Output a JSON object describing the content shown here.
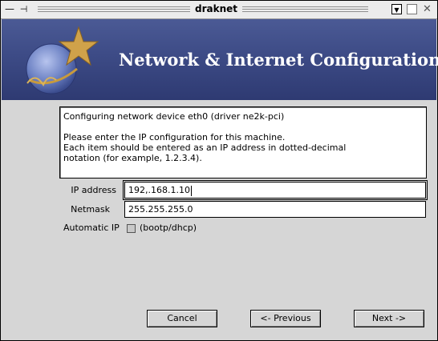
{
  "window": {
    "title": "draknet",
    "controls": {
      "minimize_glyph": "—",
      "pin_glyph": "⊣",
      "menu_glyph": "▼",
      "maximize_glyph": "",
      "close_glyph": "✕"
    }
  },
  "banner": {
    "title": "Network & Internet Configuration"
  },
  "info": {
    "text": "Configuring network device eth0 (driver ne2k-pci)\n\nPlease enter the IP configuration for this machine.\nEach item should be entered as an IP address in dotted-decimal\nnotation (for example, 1.2.3.4)."
  },
  "form": {
    "ip_label": "IP address",
    "ip_value": "192,.168.1.10",
    "netmask_label": "Netmask",
    "netmask_value": "255.255.255.0",
    "auto_label": "Automatic IP",
    "auto_option": "(bootp/dhcp)",
    "auto_checked": false
  },
  "buttons": {
    "cancel": "Cancel",
    "previous": "<- Previous",
    "next": "Next ->"
  },
  "colors": {
    "banner": "#3d4b86",
    "star": "#c89a3c",
    "globe": "#6d82c4"
  }
}
